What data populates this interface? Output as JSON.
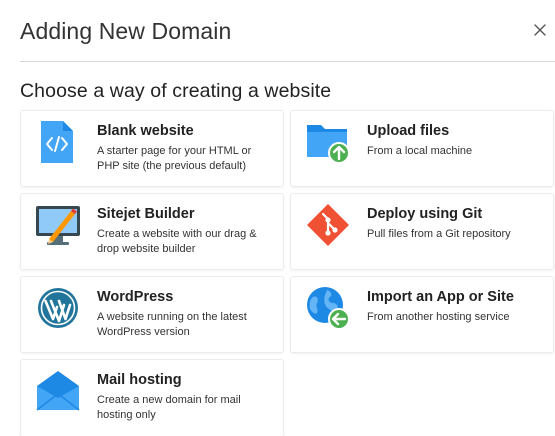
{
  "dialog": {
    "title": "Adding New Domain",
    "close_glyph": "×"
  },
  "subtitle": "Choose a way of creating a website",
  "options": [
    {
      "title": "Blank website",
      "description": "A starter page for your HTML or PHP site (the previous default)",
      "icon": "html-file-icon"
    },
    {
      "title": "Upload files",
      "description": "From a local machine",
      "icon": "folder-upload-icon"
    },
    {
      "title": "Sitejet Builder",
      "description": "Create a website with our drag & drop website builder",
      "icon": "monitor-pencil-icon"
    },
    {
      "title": "Deploy using Git",
      "description": "Pull files from a Git repository",
      "icon": "git-icon"
    },
    {
      "title": "WordPress",
      "description": "A website running on the latest WordPress version",
      "icon": "wordpress-icon"
    },
    {
      "title": "Import an App or Site",
      "description": "From another hosting service",
      "icon": "globe-import-icon"
    },
    {
      "title": "Mail hosting",
      "description": "Create a new domain for mail hosting only",
      "icon": "envelope-icon"
    }
  ],
  "colors": {
    "blue": "#1e88e5",
    "light_blue": "#42a5f5",
    "green": "#4caf50",
    "git_red": "#f05033",
    "wordpress": "#21759b"
  }
}
